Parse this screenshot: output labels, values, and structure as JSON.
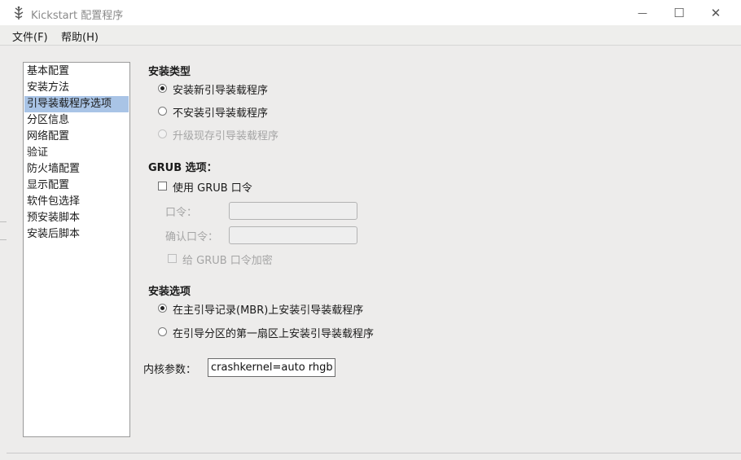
{
  "window": {
    "title": "Kickstart 配置程序",
    "controls": {
      "minimize": "—",
      "maximize": "☐",
      "close": "✕"
    }
  },
  "menu": [
    {
      "label": "文件(F)"
    },
    {
      "label": "帮助(H)"
    }
  ],
  "sidebar": {
    "selected_index": 2,
    "items": [
      {
        "label": "基本配置"
      },
      {
        "label": "安装方法"
      },
      {
        "label": "引导装载程序选项"
      },
      {
        "label": "分区信息"
      },
      {
        "label": "网络配置"
      },
      {
        "label": "验证"
      },
      {
        "label": "防火墙配置"
      },
      {
        "label": "显示配置"
      },
      {
        "label": "软件包选择"
      },
      {
        "label": "预安装脚本"
      },
      {
        "label": "安装后脚本"
      }
    ]
  },
  "install_type": {
    "title": "安装类型",
    "options": [
      {
        "label": "安装新引导装载程序",
        "selected": true,
        "enabled": true
      },
      {
        "label": "不安装引导装载程序",
        "selected": false,
        "enabled": true
      },
      {
        "label": "升级现存引导装载程序",
        "selected": false,
        "enabled": false
      }
    ]
  },
  "grub": {
    "title": "GRUB 选项：",
    "use_password": {
      "label": "使用 GRUB 口令",
      "checked": false
    },
    "password_label": "口令：",
    "confirm_label": "确认口令：",
    "encrypt": {
      "label": "给 GRUB 口令加密",
      "checked": false,
      "enabled": false
    }
  },
  "install_options": {
    "title": "安装选项",
    "options": [
      {
        "label": "在主引导记录(MBR)上安装引导装载程序",
        "selected": true
      },
      {
        "label": "在引导分区的第一扇区上安装引导装载程序",
        "selected": false
      }
    ]
  },
  "kernel": {
    "label": "内核参数：",
    "value": "crashkernel=auto rhgb"
  }
}
